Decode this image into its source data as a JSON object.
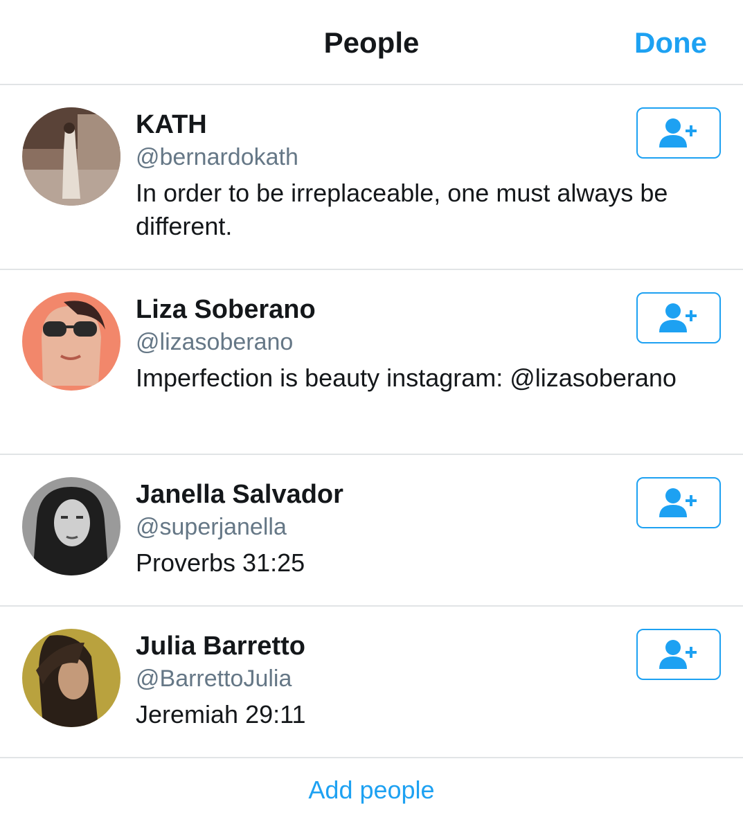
{
  "header": {
    "title": "People",
    "done_label": "Done"
  },
  "people": [
    {
      "name": "KATH",
      "handle": "@bernardokath",
      "bio": "In order to be irreplaceable, one must always be different.",
      "follow_icon": "add-user-icon"
    },
    {
      "name": "Liza Soberano",
      "handle": "@lizasoberano",
      "bio": "Imperfection is beauty instagram: @lizasoberano",
      "follow_icon": "add-user-icon"
    },
    {
      "name": "Janella Salvador",
      "handle": "@superjanella",
      "bio": "Proverbs 31:25",
      "follow_icon": "add-user-icon"
    },
    {
      "name": "Julia Barretto",
      "handle": "@BarrettoJulia",
      "bio": "Jeremiah 29:11",
      "follow_icon": "add-user-icon"
    }
  ],
  "footer": {
    "add_people_label": "Add people"
  },
  "colors": {
    "accent": "#1da1f2",
    "text": "#14171a",
    "secondary_text": "#657786",
    "divider": "#e1e4e6"
  }
}
